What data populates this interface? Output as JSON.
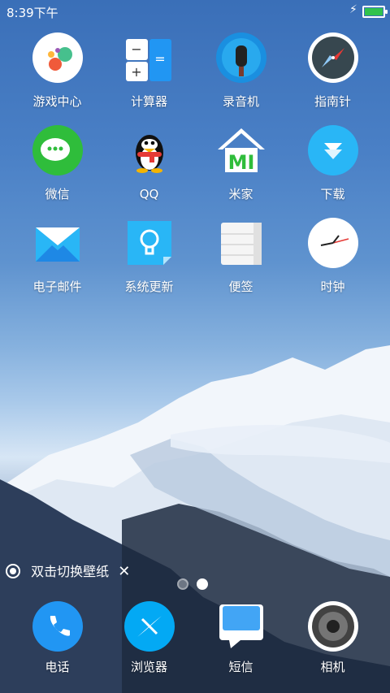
{
  "status_bar": {
    "time": "8:39下午"
  },
  "apps": [
    {
      "label": "游戏中心"
    },
    {
      "label": "计算器"
    },
    {
      "label": "录音机"
    },
    {
      "label": "指南针"
    },
    {
      "label": "微信"
    },
    {
      "label": "QQ"
    },
    {
      "label": "米家"
    },
    {
      "label": "下载"
    },
    {
      "label": "电子邮件"
    },
    {
      "label": "系统更新"
    },
    {
      "label": "便签"
    },
    {
      "label": "时钟"
    }
  ],
  "wallpaper_tip": {
    "text": "双击切换壁纸"
  },
  "dock": [
    {
      "label": "电话"
    },
    {
      "label": "浏览器"
    },
    {
      "label": "短信"
    },
    {
      "label": "相机"
    }
  ]
}
